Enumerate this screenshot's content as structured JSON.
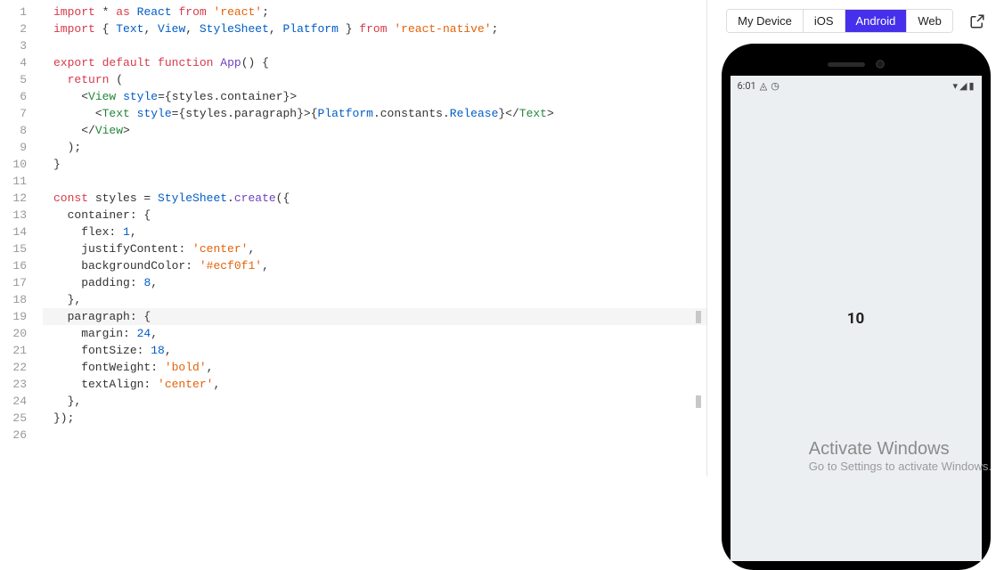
{
  "editor": {
    "lines": [
      {
        "n": 1,
        "tokens": [
          [
            "k-red",
            "import"
          ],
          [
            "txt",
            " * "
          ],
          [
            "k-red",
            "as"
          ],
          [
            "txt",
            " "
          ],
          [
            "k-blue",
            "React"
          ],
          [
            "txt",
            " "
          ],
          [
            "k-red",
            "from"
          ],
          [
            "txt",
            " "
          ],
          [
            "k-orange",
            "'react'"
          ],
          [
            "punct",
            ";"
          ]
        ]
      },
      {
        "n": 2,
        "tokens": [
          [
            "k-red",
            "import"
          ],
          [
            "txt",
            " { "
          ],
          [
            "k-blue",
            "Text"
          ],
          [
            "punct",
            ", "
          ],
          [
            "k-blue",
            "View"
          ],
          [
            "punct",
            ", "
          ],
          [
            "k-blue",
            "StyleSheet"
          ],
          [
            "punct",
            ", "
          ],
          [
            "k-blue",
            "Platform"
          ],
          [
            "txt",
            " } "
          ],
          [
            "k-red",
            "from"
          ],
          [
            "txt",
            " "
          ],
          [
            "k-orange",
            "'react-native'"
          ],
          [
            "punct",
            ";"
          ]
        ]
      },
      {
        "n": 3,
        "tokens": []
      },
      {
        "n": 4,
        "tokens": [
          [
            "k-red",
            "export"
          ],
          [
            "txt",
            " "
          ],
          [
            "k-red",
            "default"
          ],
          [
            "txt",
            " "
          ],
          [
            "k-red",
            "function"
          ],
          [
            "txt",
            " "
          ],
          [
            "k-purple",
            "App"
          ],
          [
            "punct",
            "() {"
          ]
        ]
      },
      {
        "n": 5,
        "tokens": [
          [
            "txt",
            "  "
          ],
          [
            "k-red",
            "return"
          ],
          [
            "txt",
            " ("
          ]
        ]
      },
      {
        "n": 6,
        "tokens": [
          [
            "txt",
            "    "
          ],
          [
            "punct",
            "<"
          ],
          [
            "k-teal",
            "View"
          ],
          [
            "txt",
            " "
          ],
          [
            "k-blue",
            "style"
          ],
          [
            "punct",
            "={"
          ],
          [
            "txt",
            "styles.container"
          ],
          [
            "punct",
            "}>"
          ]
        ]
      },
      {
        "n": 7,
        "tokens": [
          [
            "txt",
            "      "
          ],
          [
            "punct",
            "<"
          ],
          [
            "k-teal",
            "Text"
          ],
          [
            "txt",
            " "
          ],
          [
            "k-blue",
            "style"
          ],
          [
            "punct",
            "={"
          ],
          [
            "txt",
            "styles.paragraph"
          ],
          [
            "punct",
            "}>{"
          ],
          [
            "k-blue",
            "Platform"
          ],
          [
            "txt",
            ".constants."
          ],
          [
            "k-blue",
            "Release"
          ],
          [
            "punct",
            "}</"
          ],
          [
            "k-teal",
            "Text"
          ],
          [
            "punct",
            ">"
          ]
        ]
      },
      {
        "n": 8,
        "tokens": [
          [
            "txt",
            "    "
          ],
          [
            "punct",
            "</"
          ],
          [
            "k-teal",
            "View"
          ],
          [
            "punct",
            ">"
          ]
        ]
      },
      {
        "n": 9,
        "tokens": [
          [
            "txt",
            "  );"
          ]
        ]
      },
      {
        "n": 10,
        "tokens": [
          [
            "punct",
            "}"
          ]
        ]
      },
      {
        "n": 11,
        "tokens": []
      },
      {
        "n": 12,
        "tokens": [
          [
            "k-red",
            "const"
          ],
          [
            "txt",
            " styles = "
          ],
          [
            "k-blue",
            "StyleSheet"
          ],
          [
            "txt",
            "."
          ],
          [
            "k-purple",
            "create"
          ],
          [
            "punct",
            "({"
          ]
        ]
      },
      {
        "n": 13,
        "tokens": [
          [
            "txt",
            "  container"
          ],
          [
            "punct",
            ": {"
          ]
        ]
      },
      {
        "n": 14,
        "tokens": [
          [
            "txt",
            "    flex"
          ],
          [
            "punct",
            ": "
          ],
          [
            "k-blue",
            "1"
          ],
          [
            "punct",
            ","
          ]
        ]
      },
      {
        "n": 15,
        "tokens": [
          [
            "txt",
            "    justifyContent"
          ],
          [
            "punct",
            ": "
          ],
          [
            "k-orange",
            "'center'"
          ],
          [
            "punct",
            ","
          ]
        ]
      },
      {
        "n": 16,
        "tokens": [
          [
            "txt",
            "    backgroundColor"
          ],
          [
            "punct",
            ": "
          ],
          [
            "k-orange",
            "'#ecf0f1'"
          ],
          [
            "punct",
            ","
          ]
        ]
      },
      {
        "n": 17,
        "tokens": [
          [
            "txt",
            "    padding"
          ],
          [
            "punct",
            ": "
          ],
          [
            "k-blue",
            "8"
          ],
          [
            "punct",
            ","
          ]
        ]
      },
      {
        "n": 18,
        "tokens": [
          [
            "txt",
            "  "
          ],
          [
            "punct",
            "},"
          ]
        ]
      },
      {
        "n": 19,
        "hl": true,
        "mark": true,
        "tokens": [
          [
            "txt",
            "  paragraph"
          ],
          [
            "punct",
            ": {"
          ]
        ]
      },
      {
        "n": 20,
        "tokens": [
          [
            "txt",
            "    margin"
          ],
          [
            "punct",
            ": "
          ],
          [
            "k-blue",
            "24"
          ],
          [
            "punct",
            ","
          ]
        ]
      },
      {
        "n": 21,
        "tokens": [
          [
            "txt",
            "    fontSize"
          ],
          [
            "punct",
            ": "
          ],
          [
            "k-blue",
            "18"
          ],
          [
            "punct",
            ","
          ]
        ]
      },
      {
        "n": 22,
        "tokens": [
          [
            "txt",
            "    fontWeight"
          ],
          [
            "punct",
            ": "
          ],
          [
            "k-orange",
            "'bold'"
          ],
          [
            "punct",
            ","
          ]
        ]
      },
      {
        "n": 23,
        "tokens": [
          [
            "txt",
            "    textAlign"
          ],
          [
            "punct",
            ": "
          ],
          [
            "k-orange",
            "'center'"
          ],
          [
            "punct",
            ","
          ]
        ]
      },
      {
        "n": 24,
        "mark": true,
        "tokens": [
          [
            "txt",
            "  "
          ],
          [
            "punct",
            "},"
          ]
        ]
      },
      {
        "n": 25,
        "tokens": [
          [
            "punct",
            "});"
          ]
        ]
      },
      {
        "n": 26,
        "tokens": []
      }
    ]
  },
  "preview": {
    "tabs": {
      "my_device": "My Device",
      "ios": "iOS",
      "android": "Android",
      "web": "Web",
      "active": "android"
    },
    "status": {
      "time": "6:01",
      "wifi_icon": "▾",
      "signal_icon": "◢",
      "battery_icon": "▮"
    },
    "app_output": "10"
  },
  "watermark": {
    "title": "Activate Windows",
    "subtitle": "Go to Settings to activate Windows."
  }
}
